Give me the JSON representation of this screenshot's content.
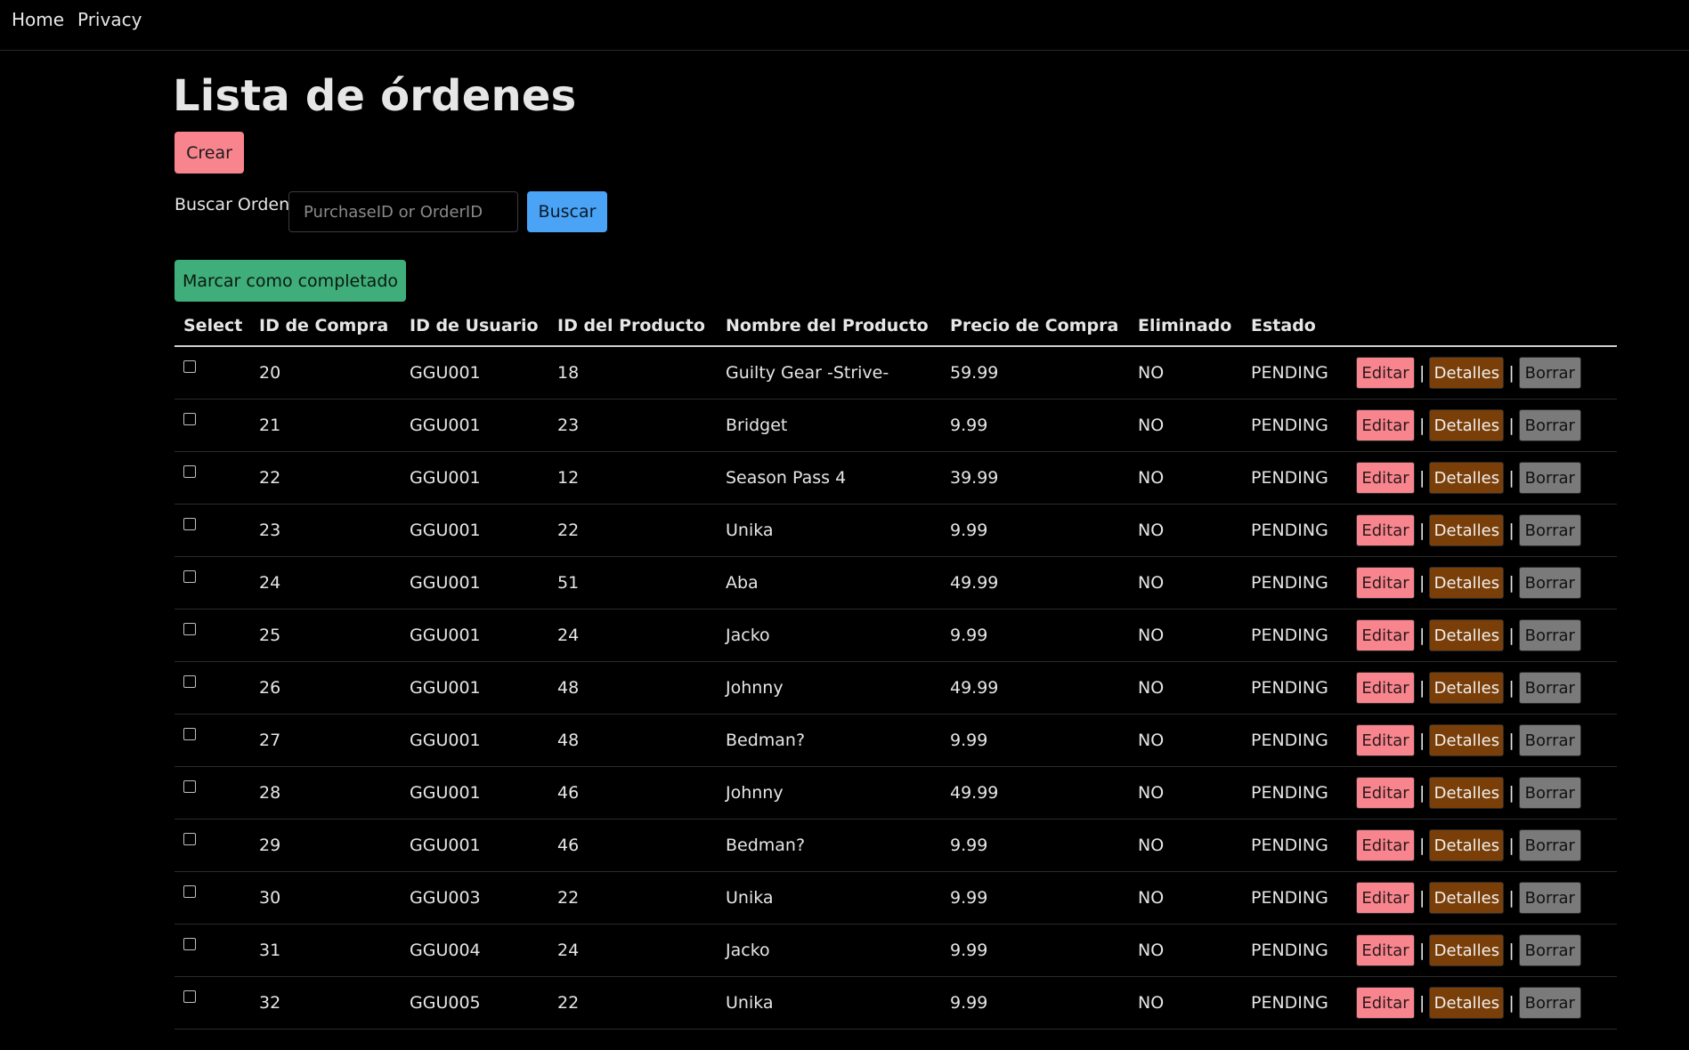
{
  "nav": {
    "home": "Home",
    "privacy": "Privacy"
  },
  "page": {
    "title": "Lista de órdenes",
    "create_label": "Crear",
    "search_label": "Buscar Orden",
    "search_placeholder": "PurchaseID or OrderID",
    "search_button": "Buscar",
    "mark_complete_label": "Marcar como completado"
  },
  "table": {
    "headers": [
      "Select",
      "ID de Compra",
      "ID de Usuario",
      "ID del Producto",
      "Nombre del Producto",
      "Precio de Compra",
      "Eliminado",
      "Estado",
      ""
    ],
    "actions": {
      "edit": "Editar",
      "details": "Detalles",
      "delete": "Borrar",
      "separator": "|"
    },
    "rows": [
      {
        "purchase_id": "20",
        "user_id": "GGU001",
        "product_id": "18",
        "product_name": "Guilty Gear -Strive-",
        "price": "59.99",
        "deleted": "NO",
        "status": "PENDING"
      },
      {
        "purchase_id": "21",
        "user_id": "GGU001",
        "product_id": "23",
        "product_name": "Bridget",
        "price": "9.99",
        "deleted": "NO",
        "status": "PENDING"
      },
      {
        "purchase_id": "22",
        "user_id": "GGU001",
        "product_id": "12",
        "product_name": "Season Pass 4",
        "price": "39.99",
        "deleted": "NO",
        "status": "PENDING"
      },
      {
        "purchase_id": "23",
        "user_id": "GGU001",
        "product_id": "22",
        "product_name": "Unika",
        "price": "9.99",
        "deleted": "NO",
        "status": "PENDING"
      },
      {
        "purchase_id": "24",
        "user_id": "GGU001",
        "product_id": "51",
        "product_name": "Aba",
        "price": "49.99",
        "deleted": "NO",
        "status": "PENDING"
      },
      {
        "purchase_id": "25",
        "user_id": "GGU001",
        "product_id": "24",
        "product_name": "Jacko",
        "price": "9.99",
        "deleted": "NO",
        "status": "PENDING"
      },
      {
        "purchase_id": "26",
        "user_id": "GGU001",
        "product_id": "48",
        "product_name": "Johnny",
        "price": "49.99",
        "deleted": "NO",
        "status": "PENDING"
      },
      {
        "purchase_id": "27",
        "user_id": "GGU001",
        "product_id": "48",
        "product_name": "Bedman?",
        "price": "9.99",
        "deleted": "NO",
        "status": "PENDING"
      },
      {
        "purchase_id": "28",
        "user_id": "GGU001",
        "product_id": "46",
        "product_name": "Johnny",
        "price": "49.99",
        "deleted": "NO",
        "status": "PENDING"
      },
      {
        "purchase_id": "29",
        "user_id": "GGU001",
        "product_id": "46",
        "product_name": "Bedman?",
        "price": "9.99",
        "deleted": "NO",
        "status": "PENDING"
      },
      {
        "purchase_id": "30",
        "user_id": "GGU003",
        "product_id": "22",
        "product_name": "Unika",
        "price": "9.99",
        "deleted": "NO",
        "status": "PENDING"
      },
      {
        "purchase_id": "31",
        "user_id": "GGU004",
        "product_id": "24",
        "product_name": "Jacko",
        "price": "9.99",
        "deleted": "NO",
        "status": "PENDING"
      },
      {
        "purchase_id": "32",
        "user_id": "GGU005",
        "product_id": "22",
        "product_name": "Unika",
        "price": "9.99",
        "deleted": "NO",
        "status": "PENDING"
      }
    ]
  },
  "colors": {
    "background": "#000000",
    "create_button": "#f8848e",
    "search_button": "#4aa3f5",
    "complete_button": "#3fae7a",
    "details_button": "#7a3f08",
    "delete_button": "#7a7a7a"
  }
}
